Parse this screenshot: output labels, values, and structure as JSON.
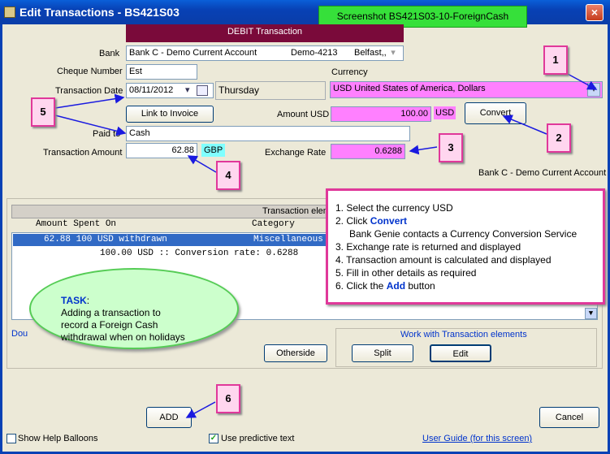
{
  "window": {
    "title": "Edit Transactions - BS421S03",
    "close_label": "×"
  },
  "banner": "Screenshot BS421S03-10-ForeignCash",
  "header": {
    "section": "DEBIT Transaction"
  },
  "form": {
    "bank_label": "Bank",
    "bank_value": "Bank C - Demo Current Account",
    "bank_code": "Demo-4213",
    "bank_location": "Belfast,,",
    "cheque_label": "Cheque Number",
    "cheque_value": "Est",
    "currency_label": "Currency",
    "currency_value": "USD United States of America, Dollars",
    "date_label": "Transaction Date",
    "date_value": "08/11/2012",
    "day_value": "Thursday",
    "link_invoice": "Link to Invoice",
    "amount_usd_label": "Amount USD",
    "amount_usd_value": "100.00",
    "amount_usd_unit": "USD",
    "convert_button": "Convert",
    "paid_to_label": "Paid to",
    "paid_to_value": "Cash",
    "txn_amount_label": "Transaction Amount",
    "txn_amount_value": "62.88",
    "txn_amount_unit": "GBP",
    "exchange_label": "Exchange Rate",
    "exchange_value": "0.6288",
    "account_note": "Bank C - Demo Current Account"
  },
  "elements": {
    "header": "Transaction elem",
    "columns": [
      "Amount Spent On",
      "Category"
    ],
    "rows": [
      {
        "text": "62.88 100 USD withdrawn",
        "category": "Miscellaneous"
      },
      {
        "text": "100.00 USD :: Conversion rate: 0.6288",
        "category": ""
      }
    ],
    "doubleclick_hint": "Dou",
    "otherside_button": "Otherside",
    "work_group_title": "Work with Transaction elements",
    "split_button": "Split",
    "edit_button": "Edit"
  },
  "footer": {
    "add_button": "ADD",
    "cancel_button": "Cancel",
    "help_balloons": "Show Help Balloons",
    "predictive": "Use predictive text",
    "user_guide": "User Guide (for this screen)"
  },
  "instructions": [
    "1. Select the currency USD",
    "2. Click ",
    "Convert",
    "Bank Genie contacts a Currency Conversion Service",
    "3. Exchange rate is returned and displayed",
    "4. Transaction amount is calculated and displayed",
    "5. Fill in other details as required",
    "6. Click the ",
    "Add",
    " button"
  ],
  "task": {
    "title": "TASK",
    "colon": ":",
    "text": [
      "Adding a transaction to",
      "record a Foreign Cash",
      "withdrawal when on holidays"
    ]
  },
  "callouts": [
    "1",
    "2",
    "3",
    "4",
    "5",
    "6"
  ],
  "colors": {
    "title_bar": "#0a3da8",
    "highlight_pink": "#ff80ff",
    "callout_border": "#e0389a",
    "banner_green": "#36e03a",
    "section_header": "#7a0a3a"
  }
}
